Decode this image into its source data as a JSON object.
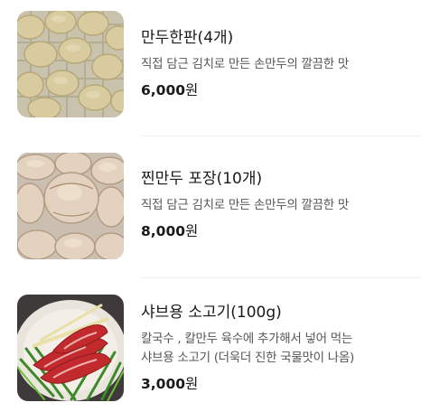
{
  "menu": {
    "items": [
      {
        "name": "만두한판(4개)",
        "description_lines": [
          "직접 담근 김치로 만든 손만두의 깔끔한 맛"
        ],
        "price": "6,000",
        "currency": "원",
        "image": "steamed-dumplings-tray-photo"
      },
      {
        "name": "찐만두 포장(10개)",
        "description_lines": [
          "직접 담근 김치로 만든 손만두의 깔끔한 맛"
        ],
        "price": "8,000",
        "currency": "원",
        "image": "packed-dumplings-photo"
      },
      {
        "name": "샤브용 소고기(100g)",
        "description_lines": [
          "칼국수 , 칼만두 육수에 추가해서 넣어 먹는",
          "샤브용 소고기 (더욱더 진한 국물맛이 나옴)"
        ],
        "price": "3,000",
        "currency": "원",
        "image": "sliced-beef-plate-photo"
      }
    ]
  },
  "colors": {
    "text_primary": "#1a1a1a",
    "text_secondary": "#555555",
    "divider": "#eeeeee"
  }
}
